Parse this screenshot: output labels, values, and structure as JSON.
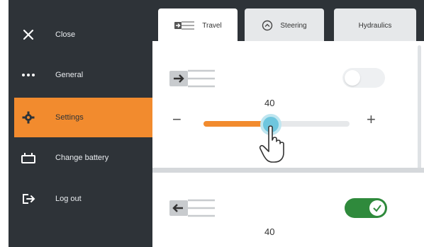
{
  "sidebar": {
    "items": [
      {
        "label": "Close",
        "icon": "close-icon"
      },
      {
        "label": "General",
        "icon": "dots-icon"
      },
      {
        "label": "Settings",
        "icon": "gear-icon",
        "active": true
      },
      {
        "label": "Change battery",
        "icon": "battery-icon"
      },
      {
        "label": "Log out",
        "icon": "logout-icon"
      }
    ]
  },
  "tabs": [
    {
      "label": "Travel",
      "icon": "travel-icon",
      "active": true
    },
    {
      "label": "Steering",
      "icon": "steering-icon"
    },
    {
      "label": "Hydraulics"
    }
  ],
  "travel": {
    "forward": {
      "toggle_on": false,
      "value": "40",
      "fraction": 0.46
    },
    "reverse": {
      "toggle_on": true,
      "value": "40"
    }
  },
  "colors": {
    "sidebar_bg": "#2e3338",
    "accent": "#f28b2e",
    "toggle_on": "#2f8a3c",
    "slider_thumb": "#6ec6de"
  }
}
